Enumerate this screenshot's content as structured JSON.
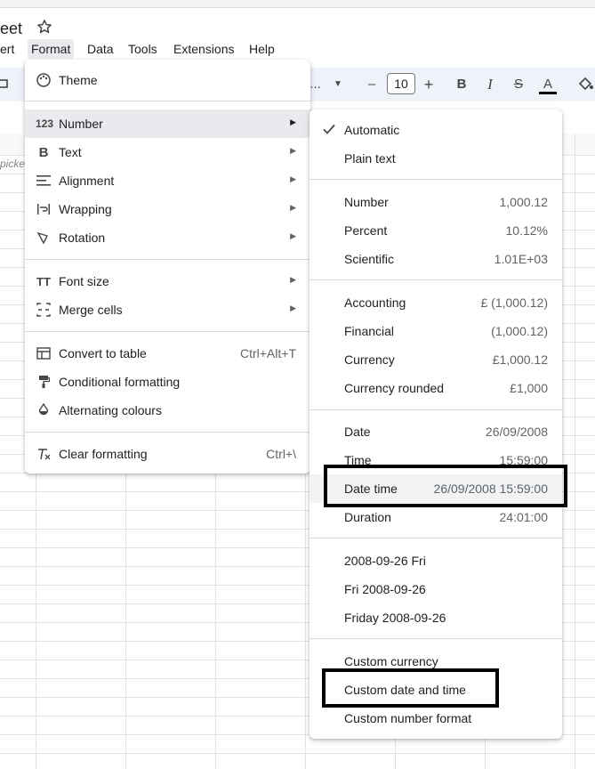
{
  "header": {
    "title_fragment": "eet",
    "menus": [
      "ert",
      "Format",
      "Data",
      "Tools",
      "Extensions",
      "Help"
    ]
  },
  "toolbar": {
    "font_fragment": "l...",
    "font_size": "10",
    "minus": "–",
    "plus": "+",
    "bold": "B",
    "italic": "I",
    "strike": "S",
    "text_color": "A"
  },
  "grid": {
    "picker_fragment": "picke"
  },
  "format_menu": {
    "items": [
      {
        "label": "Theme",
        "icon": "palette-icon"
      },
      {
        "label": "Number",
        "icon": "number-123-icon",
        "submenu": true
      },
      {
        "label": "Text",
        "icon": "bold-text-icon",
        "submenu": true
      },
      {
        "label": "Alignment",
        "icon": "align-left-icon",
        "submenu": true
      },
      {
        "label": "Wrapping",
        "icon": "wrap-icon",
        "submenu": true
      },
      {
        "label": "Rotation",
        "icon": "rotation-icon",
        "submenu": true
      },
      {
        "label": "Font size",
        "icon": "font-size-icon",
        "submenu": true
      },
      {
        "label": "Merge cells",
        "icon": "merge-cells-icon",
        "submenu": true
      },
      {
        "label": "Convert to table",
        "icon": "table-icon",
        "shortcut": "Ctrl+Alt+T"
      },
      {
        "label": "Conditional formatting",
        "icon": "paint-roller-icon"
      },
      {
        "label": "Alternating colours",
        "icon": "drop-icon"
      },
      {
        "label": "Clear formatting",
        "icon": "clear-format-icon",
        "shortcut": "Ctrl+\\"
      }
    ]
  },
  "number_menu": {
    "items": [
      {
        "label": "Automatic",
        "value": "",
        "checked": true
      },
      {
        "label": "Plain text",
        "value": ""
      },
      {
        "label": "Number",
        "value": "1,000.12"
      },
      {
        "label": "Percent",
        "value": "10.12%"
      },
      {
        "label": "Scientific",
        "value": "1.01E+03"
      },
      {
        "label": "Accounting",
        "value": "£ (1,000.12)"
      },
      {
        "label": "Financial",
        "value": "(1,000.12)"
      },
      {
        "label": "Currency",
        "value": "£1,000.12"
      },
      {
        "label": "Currency rounded",
        "value": "£1,000"
      },
      {
        "label": "Date",
        "value": "26/09/2008"
      },
      {
        "label": "Time",
        "value": "15:59:00"
      },
      {
        "label": "Date time",
        "value": "26/09/2008 15:59:00"
      },
      {
        "label": "Duration",
        "value": "24:01:00"
      },
      {
        "label": "2008-09-26 Fri",
        "value": ""
      },
      {
        "label": "Fri 2008-09-26",
        "value": ""
      },
      {
        "label": "Friday 2008-09-26",
        "value": ""
      },
      {
        "label": "Custom currency",
        "value": ""
      },
      {
        "label": "Custom date and time",
        "value": ""
      },
      {
        "label": "Custom number format",
        "value": ""
      }
    ]
  },
  "colors": {
    "menu_highlight": "#e8eaed",
    "annotation_box": "#000000"
  }
}
